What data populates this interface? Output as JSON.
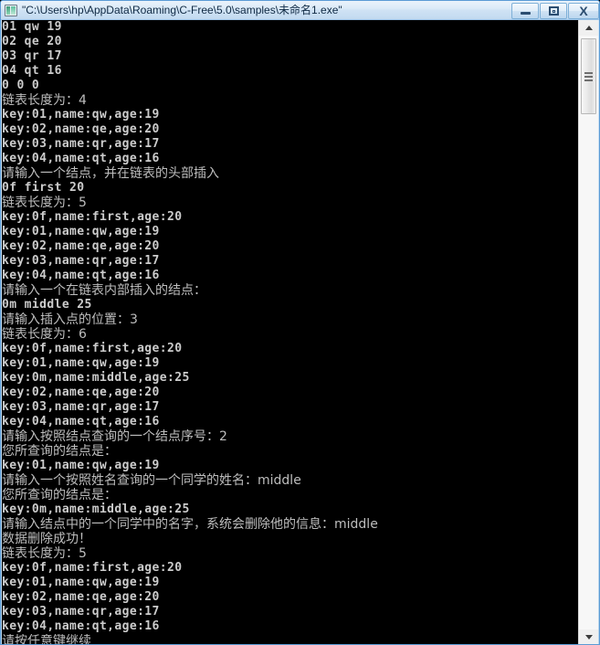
{
  "window": {
    "title": "\"C:\\Users\\hp\\AppData\\Roaming\\C-Free\\5.0\\samples\\未命名1.exe\"",
    "ghost_title": "",
    "icon": "console-app-icon",
    "controls": {
      "minimize_label": "–",
      "maximize_label": "❐",
      "close_label": "X"
    },
    "colors": {
      "frame": "#c3dcf0",
      "title_text": "#102a44",
      "console_bg": "#000000",
      "console_fg": "#c8c8c8",
      "scrollbar_bg": "#f0f0f0"
    }
  },
  "scrollbar": {
    "up_arrow": "scroll-up-arrow",
    "down_arrow": "scroll-down-arrow",
    "thumb": "scroll-thumb"
  },
  "console": {
    "lines": [
      {
        "text": "01 qw 19",
        "script": "ascii"
      },
      {
        "text": "02 qe 20",
        "script": "ascii"
      },
      {
        "text": "03 qr 17",
        "script": "ascii"
      },
      {
        "text": "04 qt 16",
        "script": "ascii"
      },
      {
        "text": "0 0 0",
        "script": "ascii"
      },
      {
        "text": "链表长度为：4",
        "script": "cjk"
      },
      {
        "text": "key:01,name:qw,age:19",
        "script": "ascii"
      },
      {
        "text": "key:02,name:qe,age:20",
        "script": "ascii"
      },
      {
        "text": "key:03,name:qr,age:17",
        "script": "ascii"
      },
      {
        "text": "key:04,name:qt,age:16",
        "script": "ascii"
      },
      {
        "text": "请输入一个结点，并在链表的头部插入",
        "script": "cjk"
      },
      {
        "text": "0f first 20",
        "script": "ascii"
      },
      {
        "text": "链表长度为：5",
        "script": "cjk"
      },
      {
        "text": "key:0f,name:first,age:20",
        "script": "ascii"
      },
      {
        "text": "key:01,name:qw,age:19",
        "script": "ascii"
      },
      {
        "text": "key:02,name:qe,age:20",
        "script": "ascii"
      },
      {
        "text": "key:03,name:qr,age:17",
        "script": "ascii"
      },
      {
        "text": "key:04,name:qt,age:16",
        "script": "ascii"
      },
      {
        "text": "请输入一个在链表内部插入的结点：",
        "script": "cjk"
      },
      {
        "text": "0m middle 25",
        "script": "ascii"
      },
      {
        "text": "请输入插入点的位置：3",
        "script": "cjk"
      },
      {
        "text": "链表长度为：6",
        "script": "cjk"
      },
      {
        "text": "key:0f,name:first,age:20",
        "script": "ascii"
      },
      {
        "text": "key:01,name:qw,age:19",
        "script": "ascii"
      },
      {
        "text": "key:0m,name:middle,age:25",
        "script": "ascii"
      },
      {
        "text": "key:02,name:qe,age:20",
        "script": "ascii"
      },
      {
        "text": "key:03,name:qr,age:17",
        "script": "ascii"
      },
      {
        "text": "key:04,name:qt,age:16",
        "script": "ascii"
      },
      {
        "text": "请输入按照结点查询的一个结点序号：2",
        "script": "cjk"
      },
      {
        "text": "您所查询的结点是：",
        "script": "cjk"
      },
      {
        "text": "key:01,name:qw,age:19",
        "script": "ascii"
      },
      {
        "text": "请输入一个按照姓名查询的一个同学的姓名：middle",
        "script": "cjk"
      },
      {
        "text": "您所查询的结点是：",
        "script": "cjk"
      },
      {
        "text": "key:0m,name:middle,age:25",
        "script": "ascii"
      },
      {
        "text": "请输入结点中的一个同学中的名字，系统会删除他的信息：middle",
        "script": "cjk"
      },
      {
        "text": "数据删除成功！",
        "script": "cjk"
      },
      {
        "text": "链表长度为：5",
        "script": "cjk"
      },
      {
        "text": "key:0f,name:first,age:20",
        "script": "ascii"
      },
      {
        "text": "key:01,name:qw,age:19",
        "script": "ascii"
      },
      {
        "text": "key:02,name:qe,age:20",
        "script": "ascii"
      },
      {
        "text": "key:03,name:qr,age:17",
        "script": "ascii"
      },
      {
        "text": "key:04,name:qt,age:16",
        "script": "ascii"
      },
      {
        "text": "请按任意键继续",
        "script": "cjk"
      }
    ]
  }
}
